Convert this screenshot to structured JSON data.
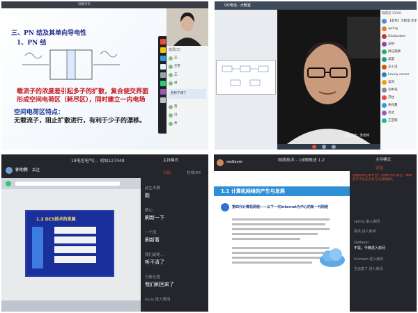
{
  "panel1": {
    "topbar_title": "屏幕共享",
    "slide": {
      "title": "三、PN 结及其单向导电性",
      "subtitle": "1、PN 结",
      "red_lines": [
        "载流子的浓度差引起多子的扩散，复合使交界面",
        "形成空间电荷区（耗尽区），同时建立一内电场"
      ],
      "section": "空间电荷区特点：",
      "feature": "无载流子，阻止扩散进行，有利于少子的漂移。"
    },
    "chat": {
      "header": "成员(2)",
      "names": [
        "王",
        "王宗",
        "王",
        "卓",
        "贺",
        "冯",
        "余"
      ],
      "note": "老师下课了"
    }
  },
  "panel2": {
    "window_title": "QQ电话 - 大教室",
    "sidebar_header": "群成员 31/60",
    "members": [
      "【老师】大教室-李老师",
      "spring",
      "Gluttonlam",
      "吴妍",
      "硕记观察",
      "高晨",
      "王小淇",
      "Lovely corner",
      "高风",
      "刘中浩",
      "开柱",
      "余权鑫",
      "高达",
      "王苗楠"
    ],
    "member_colors": [
      "#4a90d9",
      "#e07b39",
      "#c0392b",
      "#8e44ad",
      "#27ae60",
      "#16a085",
      "#d35400",
      "#2980b9",
      "#f39c12",
      "#7f8c8d",
      "#e74c3c",
      "#3498db",
      "#9b59b6",
      "#1abc9c"
    ],
    "video_caption": "正在讲话：李老师"
  },
  "panel3": {
    "course_title": "18电信电气(... 初始127448",
    "host_name": "郭助教",
    "follow": "关注",
    "mode": "主持模式",
    "tabs": [
      "讨论",
      "在线(64"
    ],
    "slide_title": "1.2 DCS技术的发展",
    "messages": [
      {
        "user": "此生不换",
        "text": "能"
      },
      {
        "user": "薪心",
        "text": "刷新一下"
      },
      {
        "user": "一个凤",
        "text": "刷新看"
      },
      {
        "user": "我们说呢...",
        "text": "听不清了"
      },
      {
        "user": "万般七度",
        "text": "我们刷回来了"
      }
    ],
    "enter_text": "louis 进入房间"
  },
  "panel4": {
    "host_name": "sedlayer",
    "course_title": "网络技术 - 18图概述 1.2",
    "mode": "主持模式",
    "tab": "讨论",
    "slide_heading": "1.1 计算机网络的产生与发展",
    "slide_subheading": "第四代计算机网络——以下一代Internet为中心的新一代网络",
    "system_notice": "提醒教师在本平台：为保护您的安全，如果您不学该天天有与QQ群相关。",
    "chat_lines": [
      "spring 进入房间",
      "高风 进入房间",
      "sedlayer",
      "不是，今晚进入房间",
      "Uniniam 进入房间",
      "王远俊了 进入房间"
    ]
  }
}
